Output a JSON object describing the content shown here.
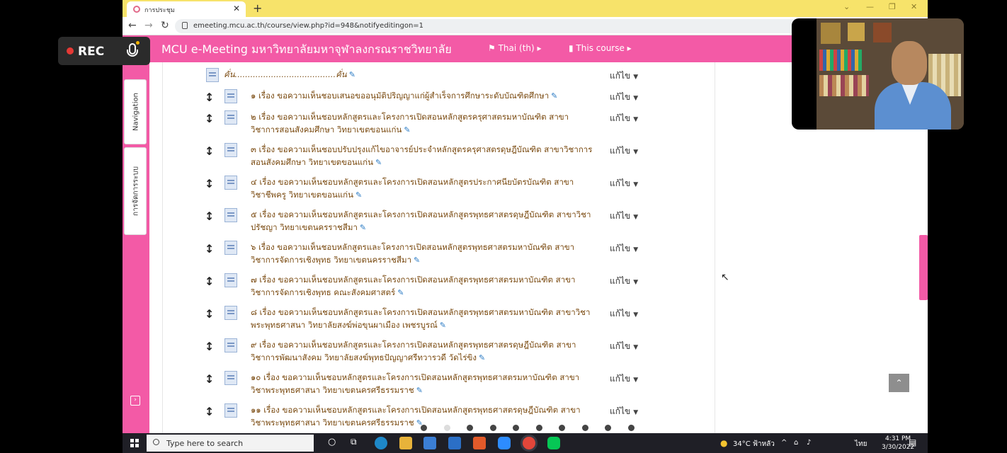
{
  "browser": {
    "tab_title": "การประชุม",
    "tab_close": "✕",
    "new_tab": "+",
    "url": "emeeting.mcu.ac.th/course/view.php?id=948&notifyeditingon=1"
  },
  "moodle": {
    "brand": "MCU e-Meeting มหาวิทยาลัยมหาจุฬาลงกรณราชวิทยาลัย",
    "language_menu": "⚑ Thai (th) ▸",
    "course_menu": "▮ This course ▸",
    "drawer_tabs": [
      "Navigation",
      "การจัดการระบบ"
    ]
  },
  "overlay": {
    "rec_label": "REC"
  },
  "course": {
    "edit_label": "แก้ไข",
    "items": [
      {
        "lines": [
          "คั่น.......................................คั่น"
        ],
        "indent": 0
      },
      {
        "lines": [
          "๑ เรื่อง ขอความเห็นชอบเสนอขออนุมัติปริญญาแก่ผู้สำเร็จการศึกษาระดับบัณฑิตศึกษา"
        ],
        "indent": 1
      },
      {
        "lines": [
          "๒ เรื่อง ขอความเห็นชอบหลักสูตรและโครงการเปิดสอนหลักสูตรครุศาสตรมหาบัณฑิต สาขา",
          "วิชาการสอนสังคมศึกษา วิทยาเขตขอนแก่น"
        ],
        "indent": 1
      },
      {
        "lines": [
          "๓ เรื่อง ขอความเห็นชอบปรับปรุงแก้ไขอาจารย์ประจำหลักสูตรครุศาสตรดุษฎีบัณฑิต สาขาวิชาการ",
          "สอนสังคมศึกษา วิทยาเขตขอนแก่น"
        ],
        "indent": 1
      },
      {
        "lines": [
          "๔ เรื่อง ขอความเห็นชอบหลักสูตรและโครงการเปิดสอนหลักสูตรประกาศนียบัตรบัณฑิต สาขา",
          "วิชาชีพครู วิทยาเขตขอนแก่น"
        ],
        "indent": 1
      },
      {
        "lines": [
          "๕ เรื่อง ขอความเห็นชอบหลักสูตรและโครงการเปิดสอนหลักสูตรพุทธศาสตรดุษฎีบัณฑิต สาขาวิชา",
          "ปรัชญา วิทยาเขตนครราชสีมา"
        ],
        "indent": 1
      },
      {
        "lines": [
          "๖ เรื่อง ขอความเห็นชอบหลักสูตรและโครงการเปิดสอนหลักสูตรพุทธศาสตรมหาบัณฑิต สาขา",
          "วิชาการจัดการเชิงพุทธ วิทยาเขตนครราชสีมา"
        ],
        "indent": 1
      },
      {
        "lines": [
          "๗ เรื่อง ขอความเห็นชอบหลักสูตรและโครงการเปิดสอนหลักสูตรพุทธศาสตรมหาบัณฑิต สาขา",
          "วิชาการจัดการเชิงพุทธ คณะสังคมศาสตร์"
        ],
        "indent": 1
      },
      {
        "lines": [
          "๘ เรื่อง ขอความเห็นชอบหลักสูตรและโครงการเปิดสอนหลักสูตรพุทธศาสตรมหาบัณฑิต สาขาวิชา",
          "พระพุทธศาสนา วิทยาลัยสงฆ์พ่อขุนผาเมือง เพชรบูรณ์"
        ],
        "indent": 1
      },
      {
        "lines": [
          "๙ เรื่อง ขอความเห็นชอบหลักสูตรและโครงการเปิดสอนหลักสูตรพุทธศาสตรดุษฎีบัณฑิต สาขา",
          "วิชาการพัฒนาสังคม วิทยาลัยสงฆ์พุทธปัญญาศรีทวารวดี วัดไร่ขิง"
        ],
        "indent": 1
      },
      {
        "lines": [
          "๑๐ เรื่อง ขอความเห็นชอบหลักสูตรและโครงการเปิดสอนหลักสูตรพุทธศาสตรมหาบัณฑิต สาขา",
          "วิชาพระพุทธศาสนา วิทยาเขตนครศรีธรรมราช"
        ],
        "indent": 1
      },
      {
        "lines": [
          "๑๑ เรื่อง ขอความเห็นชอบหลักสูตรและโครงการเปิดสอนหลักสูตรพุทธศาสตรดุษฎีบัณฑิต สาขา",
          "วิชาพระพุทธศาสนา วิทยาเขตนครศรีธรรมราช"
        ],
        "indent": 1
      }
    ]
  },
  "taskbar": {
    "search_placeholder": "Type here to search",
    "weather": "34°C ฟ้าหลัว",
    "language": "ไทย",
    "time": "4:31 PM",
    "date": "3/30/2022"
  },
  "colors": {
    "brand_pink": "#f35aa6",
    "tab_bar_yellow": "#f7e36a",
    "item_text": "#7a4a10"
  },
  "icons": {
    "move": "up-down-arrow-icon",
    "file": "document-icon",
    "edit_title": "pencil-icon",
    "back_to_top": "chevron-up-icon"
  }
}
